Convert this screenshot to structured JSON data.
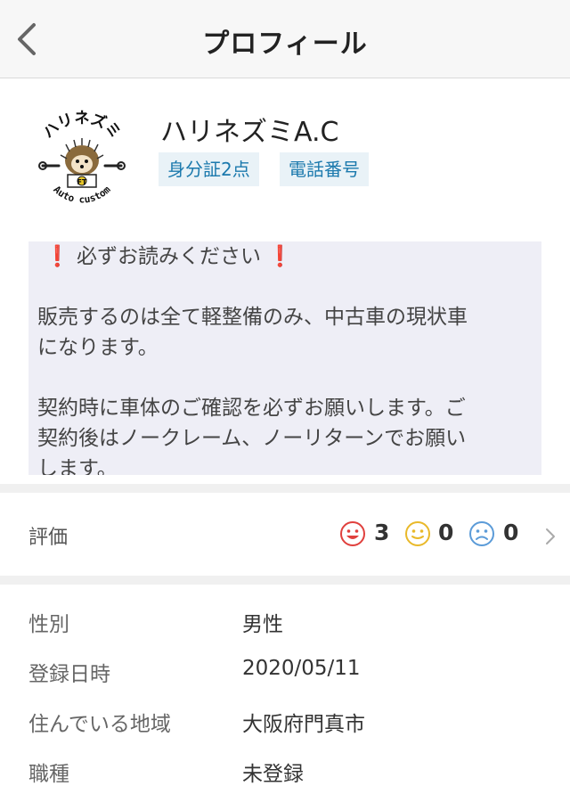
{
  "header": {
    "title": "プロフィール"
  },
  "profile": {
    "name": "ハリネズミA.C",
    "badges": [
      "身分証2点",
      "電話番号"
    ],
    "logo": {
      "arc_text": "ハリネズミ",
      "bottom_text": "Auto custom",
      "center_mark": "FT"
    }
  },
  "bio": {
    "warning": "必ずお読みください",
    "paragraph1": [
      "販売するのは全て軽整備のみ、中古車の現状車",
      "になります。"
    ],
    "paragraph2": [
      "契約時に車体のご確認を必ずお願いします。ご",
      "契約後はノークレーム、ノーリターンでお願い",
      "します。"
    ]
  },
  "rating": {
    "label": "評価",
    "good": {
      "count": "3",
      "icon": "smile-face-icon",
      "color": "#e0403d"
    },
    "normal": {
      "count": "0",
      "icon": "neutral-face-icon",
      "color": "#e9b92a"
    },
    "bad": {
      "count": "0",
      "icon": "sad-face-icon",
      "color": "#5b9bd8"
    }
  },
  "info": {
    "rows": [
      {
        "label": "性別",
        "value": "男性"
      },
      {
        "label": "登録日時",
        "value": "2020/05/11"
      },
      {
        "label": "住んでいる地域",
        "value": "大阪府門真市"
      },
      {
        "label": "職種",
        "value": "未登録"
      }
    ]
  },
  "colors": {
    "badge_bg": "#e9f2f7",
    "badge_text": "#1b79ad",
    "bio_bg": "#eeeef6",
    "warning": "#e0201d"
  }
}
